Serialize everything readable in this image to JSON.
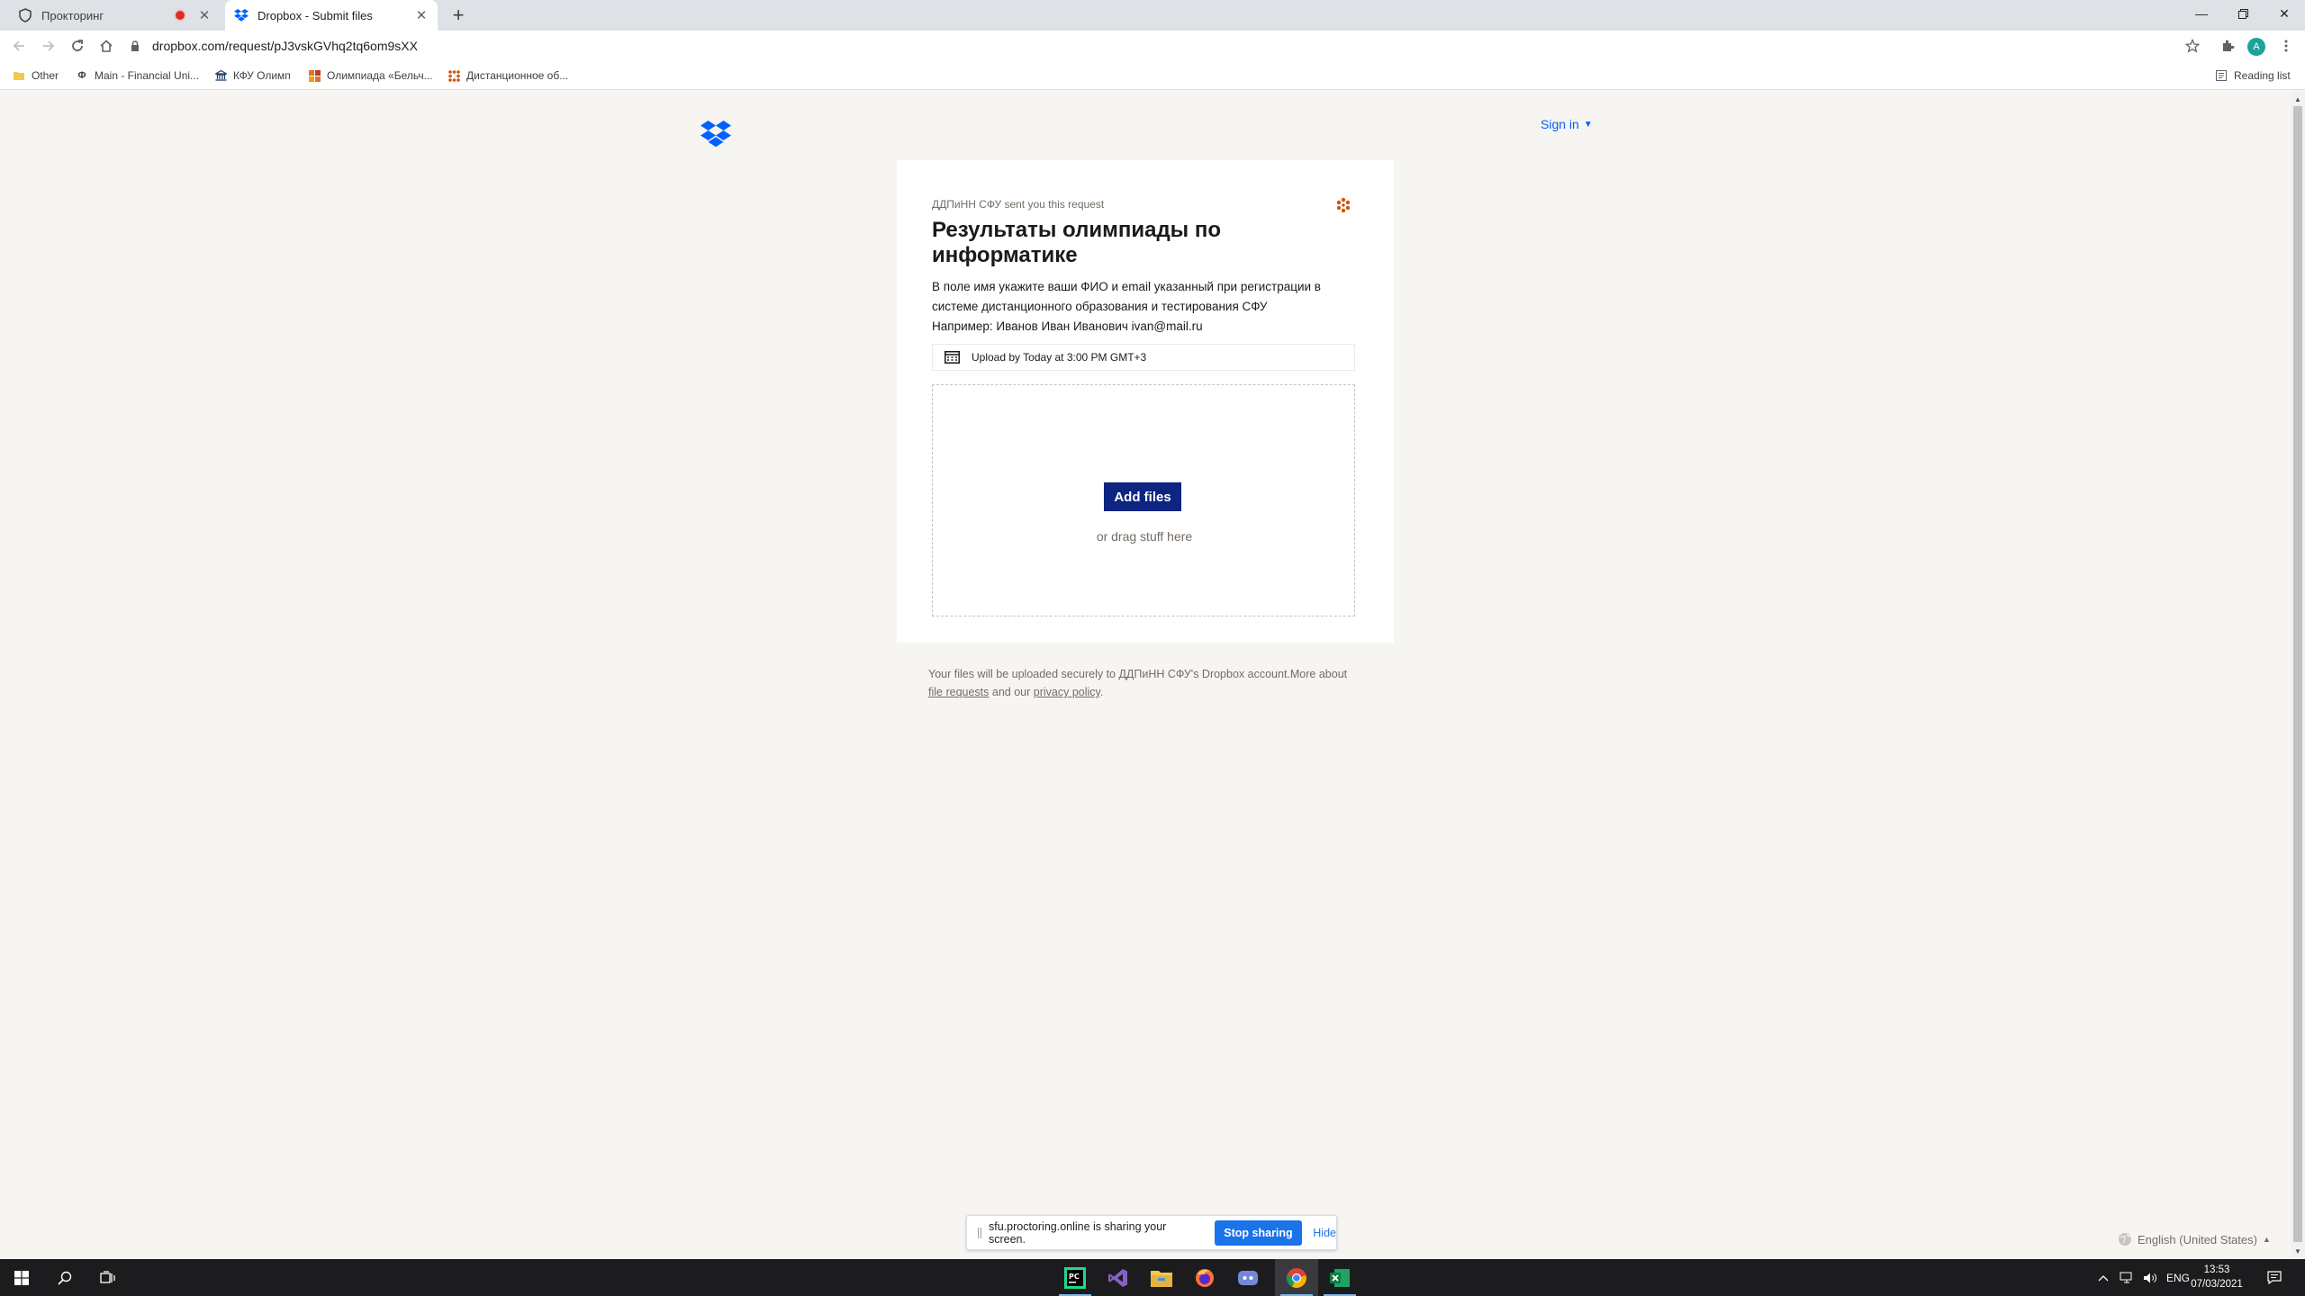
{
  "browser": {
    "tabs": [
      {
        "title": "Прокторинг",
        "icon": "shield-icon",
        "recording": true
      },
      {
        "title": "Dropbox - Submit files",
        "icon": "dropbox-icon",
        "active": true
      }
    ],
    "url": "dropbox.com/request/pJ3vskGVhq2tq6om9sXX",
    "bookmarks": [
      {
        "label": "Other",
        "icon": "folder-icon"
      },
      {
        "label": "Main - Financial Uni...",
        "icon": "phi-icon"
      },
      {
        "label": "КФУ Олимп",
        "icon": "bank-icon"
      },
      {
        "label": "Олимпиада «Бельч...",
        "icon": "grid-icon"
      },
      {
        "label": "Дистанционное об...",
        "icon": "dots-icon"
      }
    ],
    "reading_list": "Reading list",
    "profile_initial": "A"
  },
  "page": {
    "sign_in": "Sign in",
    "sender_line": "ДДПиНН СФУ sent you this request",
    "title": "Результаты олимпиады по информатике",
    "description_lines": [
      "В поле имя укажите ваши ФИО и email указанный при регистрации в",
      "системе дистанционного образования и тестирования СФУ",
      "Например: Иванов Иван Иванович ivan@mail.ru"
    ],
    "deadline": "Upload by Today at 3:00 PM GMT+3",
    "add_files": "Add files",
    "drag_text": "or drag stuff here",
    "footer": {
      "text1": "Your files will be uploaded securely to ДДПиНН СФУ's Dropbox account.More about",
      "link1": "file requests",
      "text2": "and our",
      "link2": "privacy policy",
      "text3": "."
    },
    "language": "English (United States)"
  },
  "share_bar": {
    "message": "sfu.proctoring.online is sharing your screen.",
    "stop": "Stop sharing",
    "hide": "Hide"
  },
  "taskbar": {
    "lang": "ENG",
    "time": "13:53",
    "date": "07/03/2021"
  },
  "colors": {
    "dropbox_blue": "#0061fe",
    "add_files_bg": "#0d2481",
    "page_bg": "#f7f5f2",
    "chrome_blue": "#1a73e8"
  }
}
